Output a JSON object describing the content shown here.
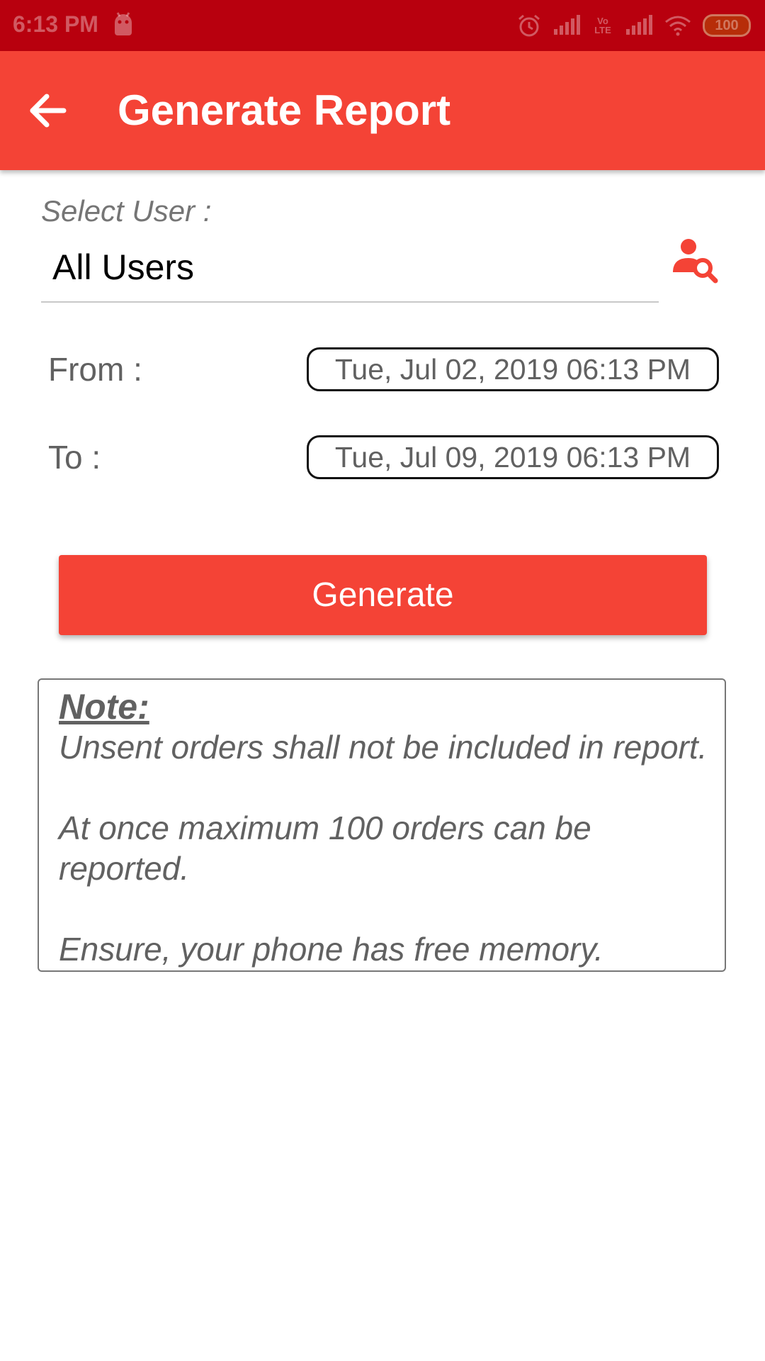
{
  "status_bar": {
    "time": "6:13 PM",
    "battery": "100",
    "volte": "Vo LTE",
    "icons": [
      "android-icon",
      "alarm-icon",
      "signal-icon",
      "volte-icon",
      "signal-icon",
      "wifi-icon",
      "battery-icon"
    ]
  },
  "app_bar": {
    "title": "Generate Report",
    "back_icon": "arrow-back-icon",
    "color": "#f44336"
  },
  "user_select": {
    "label": "Select User :",
    "value": "All Users",
    "icon": "user-search-icon"
  },
  "date_range": {
    "from_label": "From :",
    "from_value": "Tue, Jul 02, 2019 06:13 PM",
    "to_label": "To :",
    "to_value": "Tue, Jul 09, 2019 06:13 PM"
  },
  "generate_button": {
    "label": "Generate"
  },
  "note": {
    "title": "Note:",
    "line1": "Unsent orders shall not be included in report.",
    "line2": "At once maximum 100 orders can be",
    "line3": "reported.",
    "line4": "Ensure, your phone has free memory."
  },
  "colors": {
    "status_bar": "#b8000e",
    "accent": "#f44336",
    "text_gray": "#616161"
  }
}
